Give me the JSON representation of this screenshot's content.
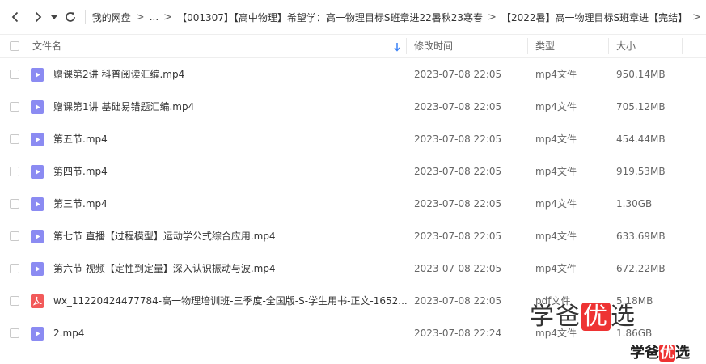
{
  "breadcrumb": {
    "items": [
      "我的网盘",
      "...",
      "【001307】【高中物理】希望学：高一物理目标S班章进22暑秋23寒春",
      "【2022暑】高一物理目标S班章进【完结】"
    ]
  },
  "table": {
    "headers": {
      "name": "文件名",
      "modified": "修改时间",
      "type": "类型",
      "size": "大小"
    },
    "rows": [
      {
        "name": "赠课第2讲 科普阅读汇编.mp4",
        "modified": "2023-07-08 22:05",
        "type": "mp4文件",
        "size": "950.14MB",
        "icon": "video-file-icon"
      },
      {
        "name": "赠课第1讲 基础易错题汇编.mp4",
        "modified": "2023-07-08 22:05",
        "type": "mp4文件",
        "size": "705.12MB",
        "icon": "video-file-icon"
      },
      {
        "name": "第五节.mp4",
        "modified": "2023-07-08 22:05",
        "type": "mp4文件",
        "size": "454.44MB",
        "icon": "video-file-icon"
      },
      {
        "name": "第四节.mp4",
        "modified": "2023-07-08 22:05",
        "type": "mp4文件",
        "size": "919.53MB",
        "icon": "video-file-icon"
      },
      {
        "name": "第三节.mp4",
        "modified": "2023-07-08 22:05",
        "type": "mp4文件",
        "size": "1.30GB",
        "icon": "video-file-icon"
      },
      {
        "name": "第七节 直播【过程模型】运动学公式综合应用.mp4",
        "modified": "2023-07-08 22:05",
        "type": "mp4文件",
        "size": "633.69MB",
        "icon": "video-file-icon"
      },
      {
        "name": "第六节 视频【定性到定量】深入认识振动与波.mp4",
        "modified": "2023-07-08 22:05",
        "type": "mp4文件",
        "size": "672.22MB",
        "icon": "video-file-icon"
      },
      {
        "name": "wx_11220424477784-高一物理培训班-三季度-全国版-S-学生用书-正文-1652...",
        "modified": "2023-07-08 22:05",
        "type": "pdf文件",
        "size": "5.18MB",
        "icon": "pdf-file-icon"
      },
      {
        "name": "2.mp4",
        "modified": "2023-07-08 22:24",
        "type": "mp4文件",
        "size": "1.86GB",
        "icon": "video-file-icon"
      }
    ]
  },
  "watermark": {
    "a": "学爸",
    "b": "优",
    "c": "选"
  },
  "colors": {
    "video_icon": "#8b8bf2",
    "pdf_icon": "#f25a5a",
    "sort_arrow": "#3b82f6"
  }
}
